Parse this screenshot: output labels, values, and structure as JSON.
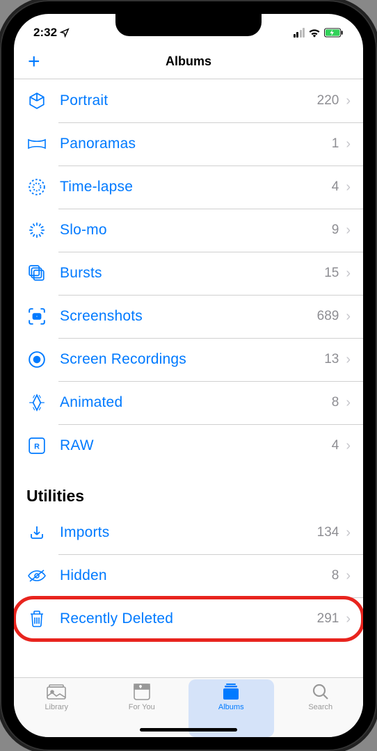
{
  "status": {
    "time": "2:32"
  },
  "header": {
    "title": "Albums",
    "add": "+"
  },
  "media_types": [
    {
      "icon": "cube-icon",
      "label": "Portrait",
      "count": "220"
    },
    {
      "icon": "panorama-icon",
      "label": "Panoramas",
      "count": "1"
    },
    {
      "icon": "timelapse-icon",
      "label": "Time-lapse",
      "count": "4"
    },
    {
      "icon": "slomo-icon",
      "label": "Slo-mo",
      "count": "9"
    },
    {
      "icon": "bursts-icon",
      "label": "Bursts",
      "count": "15"
    },
    {
      "icon": "screenshot-icon",
      "label": "Screenshots",
      "count": "689"
    },
    {
      "icon": "record-icon",
      "label": "Screen Recordings",
      "count": "13"
    },
    {
      "icon": "animated-icon",
      "label": "Animated",
      "count": "8"
    },
    {
      "icon": "raw-icon",
      "label": "RAW",
      "count": "4"
    }
  ],
  "utilities_title": "Utilities",
  "utilities": [
    {
      "icon": "import-icon",
      "label": "Imports",
      "count": "134"
    },
    {
      "icon": "hidden-icon",
      "label": "Hidden",
      "count": "8"
    },
    {
      "icon": "trash-icon",
      "label": "Recently Deleted",
      "count": "291"
    }
  ],
  "tabs": {
    "library": "Library",
    "foryou": "For You",
    "albums": "Albums",
    "search": "Search"
  }
}
